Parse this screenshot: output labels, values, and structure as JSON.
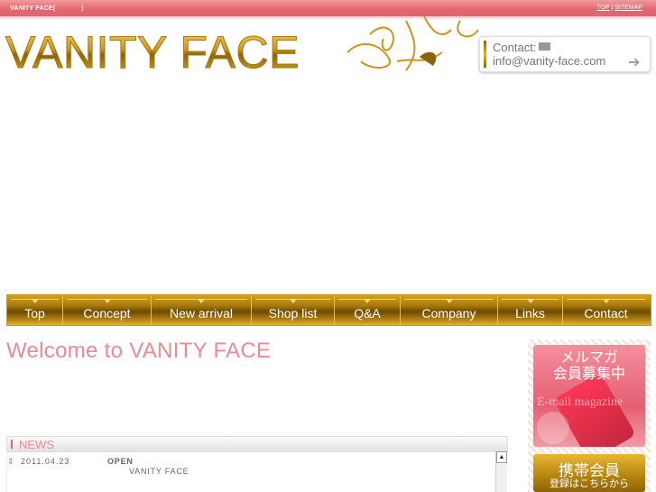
{
  "topbar": {
    "site_label": "VANITY FACE(　　　　)",
    "links": [
      {
        "label": "TOP"
      },
      {
        "label": "SITEMAP"
      }
    ],
    "separator": "|"
  },
  "header": {
    "logo": "VANITY FACE",
    "contact": {
      "label": "Contact:",
      "email": "info@vanity-face.com",
      "arrow": "➔"
    }
  },
  "nav": {
    "items": [
      {
        "label": "Top"
      },
      {
        "label": "Concept"
      },
      {
        "label": "New arrival"
      },
      {
        "label": "Shop list"
      },
      {
        "label": "Q&A"
      },
      {
        "label": "Company"
      },
      {
        "label": "Links"
      },
      {
        "label": "Contact"
      }
    ]
  },
  "main": {
    "welcome": "Welcome to VANITY FACE",
    "news": {
      "heading": "NEWS",
      "items": [
        {
          "icon": "⇕",
          "date": "2011.04.23",
          "title": "OPEN",
          "body": "VANITY FACE"
        }
      ]
    }
  },
  "sidebar": {
    "mailmag": {
      "line1": "メルマガ",
      "line2": "会員募集中",
      "sub": "E-mail magazine"
    },
    "mobile": {
      "line1": "携帯会員",
      "line2": "登録はこちらから"
    }
  },
  "colors": {
    "accent_pink": "#e4656d",
    "gold": "#b3830d"
  }
}
